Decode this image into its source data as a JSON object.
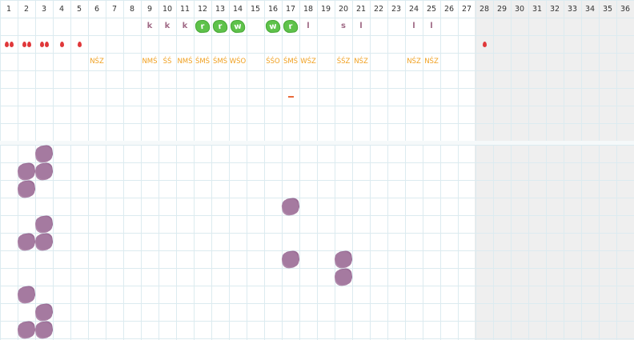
{
  "days": [
    "1",
    "2",
    "3",
    "4",
    "5",
    "6",
    "7",
    "8",
    "9",
    "10",
    "11",
    "12",
    "13",
    "14",
    "15",
    "16",
    "17",
    "18",
    "19",
    "20",
    "21",
    "22",
    "23",
    "24",
    "25",
    "26",
    "27",
    "28",
    "29",
    "30",
    "31",
    "32",
    "33",
    "34",
    "35",
    "36"
  ],
  "shaded_from_day": 28,
  "colors": {
    "grid": "#dcebf0",
    "shaded": "#efefef",
    "letter": "#a06a86",
    "leaf": "#5ec24a",
    "code": "#f0a020",
    "drop": "#e0383a",
    "blot": "#a57aa0"
  },
  "drops": [
    {
      "day": 1,
      "count": 2
    },
    {
      "day": 2,
      "count": 2
    },
    {
      "day": 3,
      "count": 2
    },
    {
      "day": 4,
      "count": 1
    },
    {
      "day": 5,
      "count": 1
    },
    {
      "day": 28,
      "count": 1
    }
  ],
  "letters": [
    {
      "day": 9,
      "text": "k",
      "style": "plain"
    },
    {
      "day": 10,
      "text": "k",
      "style": "plain"
    },
    {
      "day": 11,
      "text": "k",
      "style": "plain"
    },
    {
      "day": 12,
      "text": "r",
      "style": "leaf"
    },
    {
      "day": 13,
      "text": "r",
      "style": "leaf"
    },
    {
      "day": 14,
      "text": "w",
      "style": "leaf"
    },
    {
      "day": 16,
      "text": "w",
      "style": "leaf"
    },
    {
      "day": 17,
      "text": "r",
      "style": "leaf"
    },
    {
      "day": 18,
      "text": "l",
      "style": "plain"
    },
    {
      "day": 20,
      "text": "s",
      "style": "plain"
    },
    {
      "day": 21,
      "text": "l",
      "style": "plain"
    },
    {
      "day": 24,
      "text": "l",
      "style": "plain"
    },
    {
      "day": 25,
      "text": "l",
      "style": "plain"
    }
  ],
  "codes": [
    {
      "day": 6,
      "text": "NŚZ"
    },
    {
      "day": 9,
      "text": "NMŚ"
    },
    {
      "day": 10,
      "text": "ŚŚ"
    },
    {
      "day": 11,
      "text": "NMŚ"
    },
    {
      "day": 12,
      "text": "ŚMŚ"
    },
    {
      "day": 13,
      "text": "ŚMŚ"
    },
    {
      "day": 14,
      "text": "WŚO"
    },
    {
      "day": 16,
      "text": "ŚŚO"
    },
    {
      "day": 17,
      "text": "ŚMŚ"
    },
    {
      "day": 18,
      "text": "WŚZ"
    },
    {
      "day": 20,
      "text": "ŚŚZ"
    },
    {
      "day": 21,
      "text": "NŚZ"
    },
    {
      "day": 24,
      "text": "NŚZ"
    },
    {
      "day": 25,
      "text": "NŚZ"
    }
  ],
  "dashes": [
    {
      "day": 17
    }
  ],
  "blots": [
    {
      "day": 3,
      "row": 0
    },
    {
      "day": 2,
      "row": 1
    },
    {
      "day": 3,
      "row": 1
    },
    {
      "day": 2,
      "row": 2
    },
    {
      "day": 17,
      "row": 3
    },
    {
      "day": 3,
      "row": 4
    },
    {
      "day": 2,
      "row": 5
    },
    {
      "day": 3,
      "row": 5
    },
    {
      "day": 17,
      "row": 6
    },
    {
      "day": 20,
      "row": 6
    },
    {
      "day": 20,
      "row": 7
    },
    {
      "day": 2,
      "row": 8
    },
    {
      "day": 3,
      "row": 9
    },
    {
      "day": 2,
      "row": 10
    },
    {
      "day": 3,
      "row": 10
    }
  ]
}
